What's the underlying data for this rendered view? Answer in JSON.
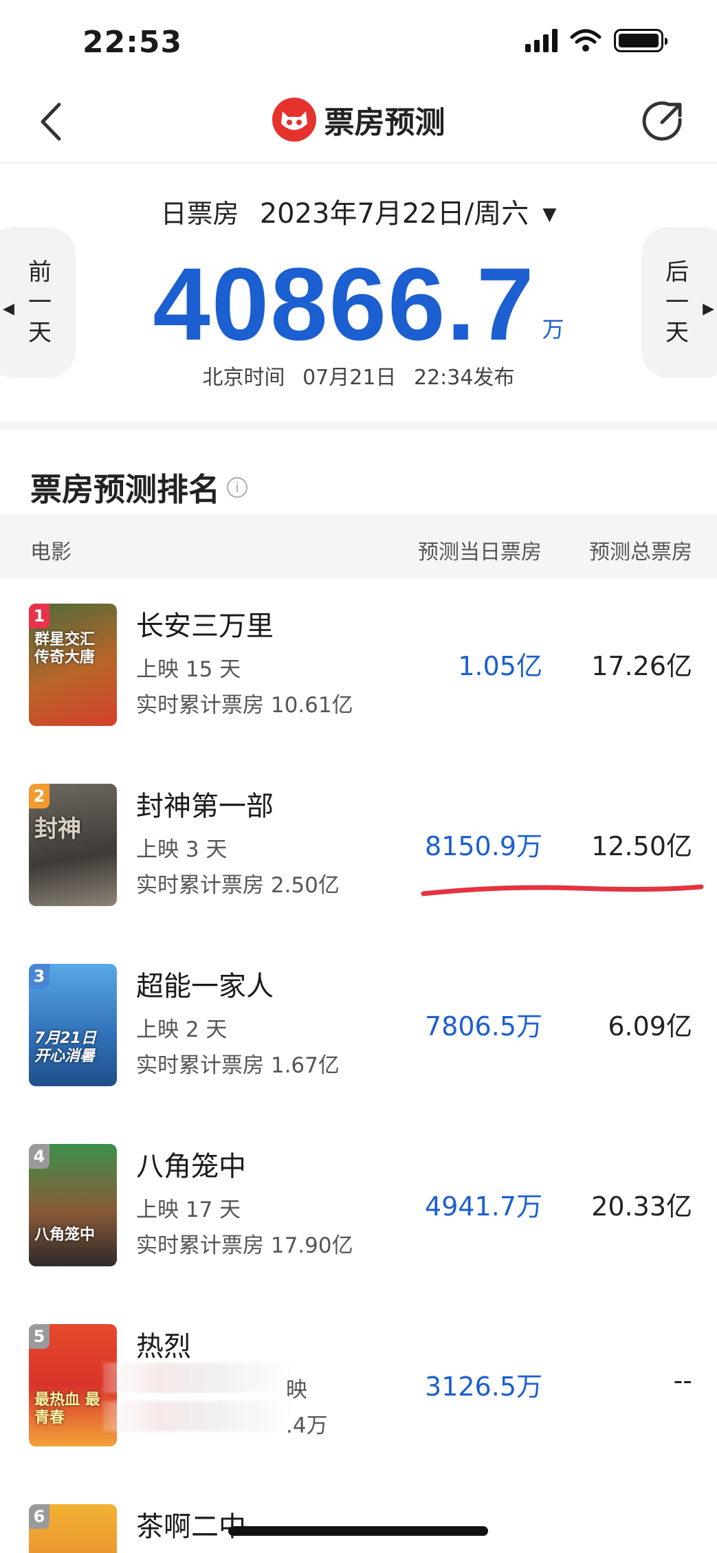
{
  "status_bar": {
    "time": "22:53"
  },
  "nav": {
    "title": "票房预测"
  },
  "header": {
    "date_label": "日票房",
    "date_value": "2023年7月22日/周六",
    "prev_day": [
      "前",
      "一",
      "天"
    ],
    "next_day": [
      "后",
      "一",
      "天"
    ],
    "box_office": "40866.7",
    "unit": "万",
    "release_prefix": "北京时间",
    "release_date": "07月21日",
    "release_time": "22:34发布"
  },
  "ranking": {
    "title": "票房预测排名",
    "columns": {
      "movie": "电影",
      "day": "预测当日票房",
      "total": "预测总票房"
    },
    "movies": [
      {
        "rank": "1",
        "title": "长安三万里",
        "days": "上映 15 天",
        "cumulative": "实时累计票房 10.61亿",
        "day_box": "1.05亿",
        "total": "17.26亿",
        "badge_color": "#e8334a",
        "poster_text": "群星交汇 传奇大唐"
      },
      {
        "rank": "2",
        "title": "封神第一部",
        "days": "上映 3 天",
        "cumulative": "实时累计票房 2.50亿",
        "day_box": "8150.9万",
        "total": "12.50亿",
        "badge_color": "#f29a2e",
        "poster_text": "封神"
      },
      {
        "rank": "3",
        "title": "超能一家人",
        "days": "上映 2 天",
        "cumulative": "实时累计票房 1.67亿",
        "day_box": "7806.5万",
        "total": "6.09亿",
        "badge_color": "#4b86d6",
        "poster_text": "7月21日 开心消暑"
      },
      {
        "rank": "4",
        "title": "八角笼中",
        "days": "上映 17 天",
        "cumulative": "实时累计票房 17.90亿",
        "day_box": "4941.7万",
        "total": "20.33亿",
        "badge_color": "#9a9a9a",
        "poster_text": "八角笼中"
      },
      {
        "rank": "5",
        "title": "热烈",
        "days": "映",
        "cumulative": ".4万",
        "day_box": "3126.5万",
        "total": "--",
        "badge_color": "#9a9a9a",
        "poster_text": "最热血 最青春"
      },
      {
        "rank": "6",
        "title": "茶啊二中",
        "days": "",
        "cumulative": "",
        "day_box": "",
        "total": "",
        "badge_color": "#9a9a9a",
        "poster_text": ""
      }
    ]
  }
}
